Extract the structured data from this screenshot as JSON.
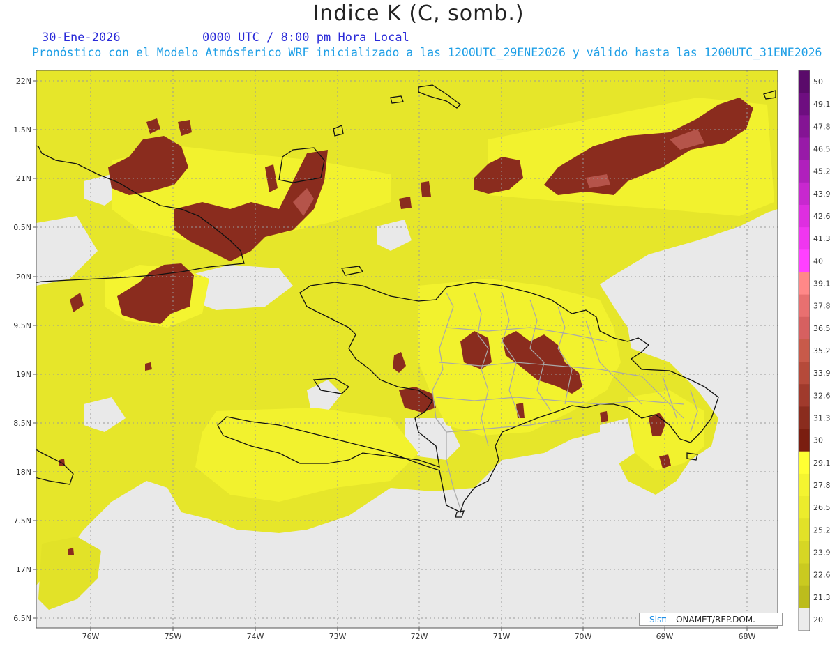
{
  "header": {
    "title": "Indice K (C, somb.)",
    "date": "30-Ene-2026",
    "time": "0000 UTC / 8:00 pm Hora Local",
    "forecast": "Pronóstico con el Modelo Atmósferico WRF inicializado a las 1200UTC_29ENE2026 y válido hasta las  1200UTC_31ENE2026"
  },
  "axes": {
    "lat_labels": [
      "22N",
      "1.5N",
      "21N",
      "0.5N",
      "20N",
      "9.5N",
      "19N",
      "8.5N",
      "18N",
      "7.5N",
      "17N",
      "6.5N"
    ],
    "lon_labels": [
      "76W",
      "75W",
      "74W",
      "73W",
      "72W",
      "71W",
      "70W",
      "69W",
      "68W"
    ]
  },
  "colorbar": {
    "labels": [
      "50",
      "49.1",
      "47.8",
      "46.5",
      "45.2",
      "43.9",
      "42.6",
      "41.3",
      "40",
      "39.1",
      "37.8",
      "36.5",
      "35.2",
      "33.9",
      "32.6",
      "31.3",
      "30",
      "29.1",
      "27.8",
      "26.5",
      "25.2",
      "23.9",
      "22.6",
      "21.3",
      "20"
    ],
    "colors": [
      "#5a0a6a",
      "#6e0e80",
      "#841494",
      "#981aa8",
      "#b020bc",
      "#c828cf",
      "#de2ee0",
      "#f036f0",
      "#ff40ff",
      "#ff8888",
      "#e87070",
      "#d66060",
      "#c85a4a",
      "#b54a3a",
      "#a03a2c",
      "#8a2c1e",
      "#7a1e10",
      "#ffff33",
      "#f4f430",
      "#ecec2c",
      "#e2e228",
      "#d6d624",
      "#caca20",
      "#bcbc1c",
      "#ececec"
    ]
  },
  "credit": {
    "sis": "Sisπ",
    "text": " – ONAMET/REP.DOM."
  }
}
